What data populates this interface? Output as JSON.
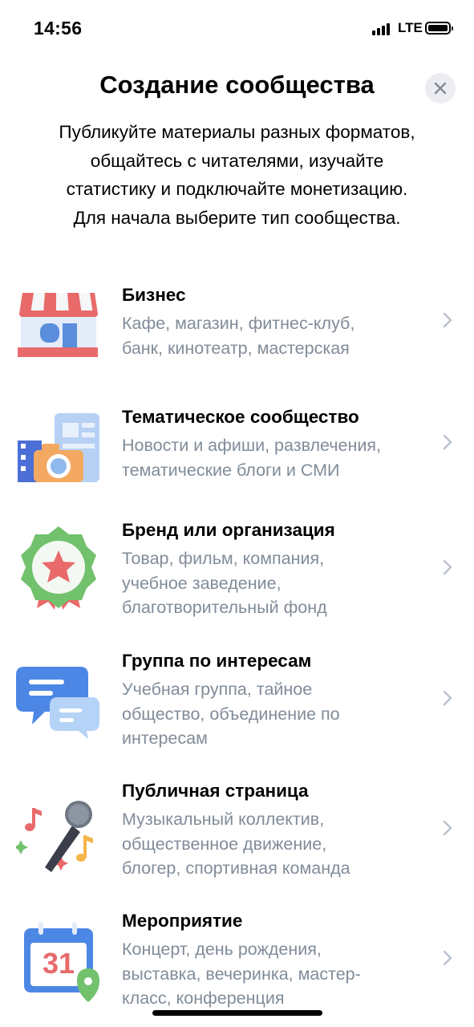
{
  "status_bar": {
    "time": "14:56",
    "network": "LTE"
  },
  "header": {
    "title": "Создание сообщества",
    "subtitle_lines": [
      "Публикуйте материалы разных форматов,",
      "общайтесь с читателями, изучайте",
      "статистику и подключайте монетизацию.",
      "Для начала выберите тип сообщества."
    ]
  },
  "community_types": [
    {
      "title": "Бизнес",
      "desc_lines": [
        "Кафе, магазин, фитнес-клуб,",
        "банк, кинотеатр, мастерская"
      ],
      "icon": "shop-icon"
    },
    {
      "title": "Тематическое сообщество",
      "desc_lines": [
        "Новости и афиши, развлечения,",
        "тематические блоги и СМИ"
      ],
      "icon": "media-icon"
    },
    {
      "title": "Бренд или организация",
      "desc_lines": [
        "Товар, фильм, компания,",
        "учебное заведение,",
        "благотворительный фонд"
      ],
      "icon": "award-icon"
    },
    {
      "title": "Группа по интересам",
      "desc_lines": [
        "Учебная группа, тайное",
        "общество, объединение по",
        "интересам"
      ],
      "icon": "chat-bubbles-icon"
    },
    {
      "title": "Публичная страница",
      "desc_lines": [
        "Музыкальный коллектив,",
        "общественное движение,",
        "блогер, спортивная команда"
      ],
      "icon": "microphone-icon"
    },
    {
      "title": "Мероприятие",
      "desc_lines": [
        "Концерт, день рождения,",
        "выставка, вечеринка, мастер-",
        "класс, конференция"
      ],
      "icon": "calendar-icon",
      "calendar_day": "31"
    }
  ],
  "colors": {
    "secondary_text": "#818c99",
    "chevron": "#b8c1cc",
    "close_bg": "#ebedf0"
  }
}
